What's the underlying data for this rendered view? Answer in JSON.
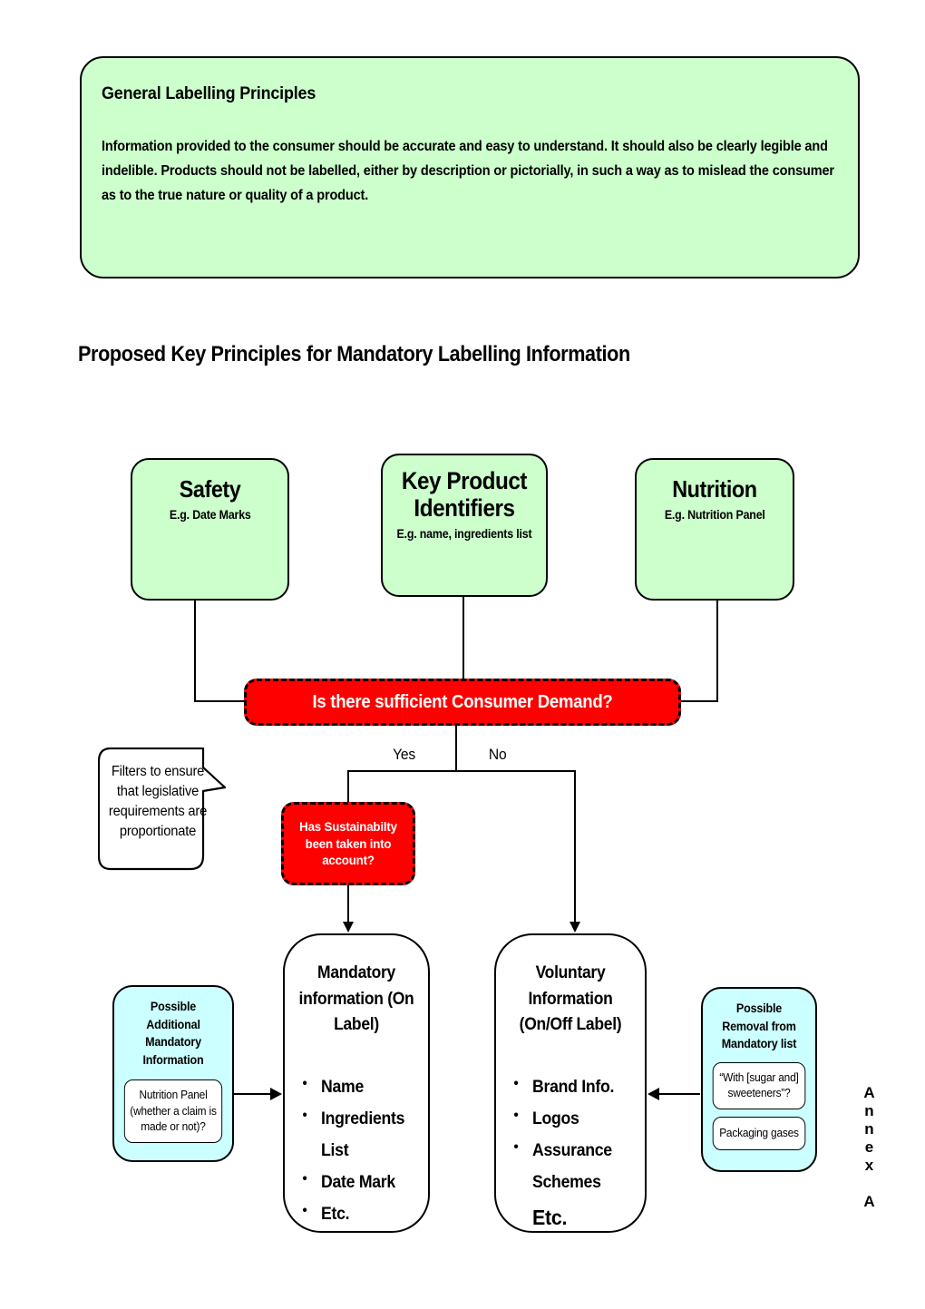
{
  "principles": {
    "title": "General Labelling Principles",
    "body": "Information provided to the consumer should be accurate and easy to understand. It should also be clearly legible and indelible. Products should not be labelled, either by description or pictorially, in such a way as to mislead the consumer as to the true nature or quality of a product."
  },
  "section_heading": "Proposed Key Principles for Mandatory Labelling Information",
  "principle_boxes": [
    {
      "title": "Safety",
      "subtitle": "E.g. Date Marks"
    },
    {
      "title": "Key Product Identifiers",
      "subtitle": "E.g. name, ingredients list"
    },
    {
      "title": "Nutrition",
      "subtitle": "E.g. Nutrition Panel"
    }
  ],
  "decisions": {
    "demand": "Is there sufficient Consumer Demand?",
    "sustainability": "Has Sustainabilty been taken into account?"
  },
  "branches": {
    "yes": "Yes",
    "no": "No"
  },
  "callout": {
    "text": "Filters to ensure that legislative requirements are proportionate"
  },
  "outcomes": [
    {
      "title": "Mandatory information (On Label)",
      "items": [
        "Name",
        "Ingredients List",
        "Date Mark",
        "Etc."
      ]
    },
    {
      "title": "Voluntary Information (On/Off Label)",
      "items": [
        "Brand Info.",
        "Logos",
        "Assurance"
      ],
      "continuation": "Schemes",
      "continuation_suffix": "Etc."
    }
  ],
  "side_boxes": {
    "additional": {
      "title": "Possible Additional Mandatory Information",
      "items": [
        "Nutrition Panel (whether a claim is made or not)?"
      ]
    },
    "removal": {
      "title": "Possible Removal from Mandatory list",
      "items": [
        "“With [sugar and] sweeteners”?",
        "Packaging gases"
      ]
    }
  },
  "annex_label": "Annex A",
  "colors": {
    "green": "#ccffcc",
    "red": "#ff0000",
    "cyan": "#ccffff",
    "outline": "#000000",
    "white": "#ffffff"
  }
}
